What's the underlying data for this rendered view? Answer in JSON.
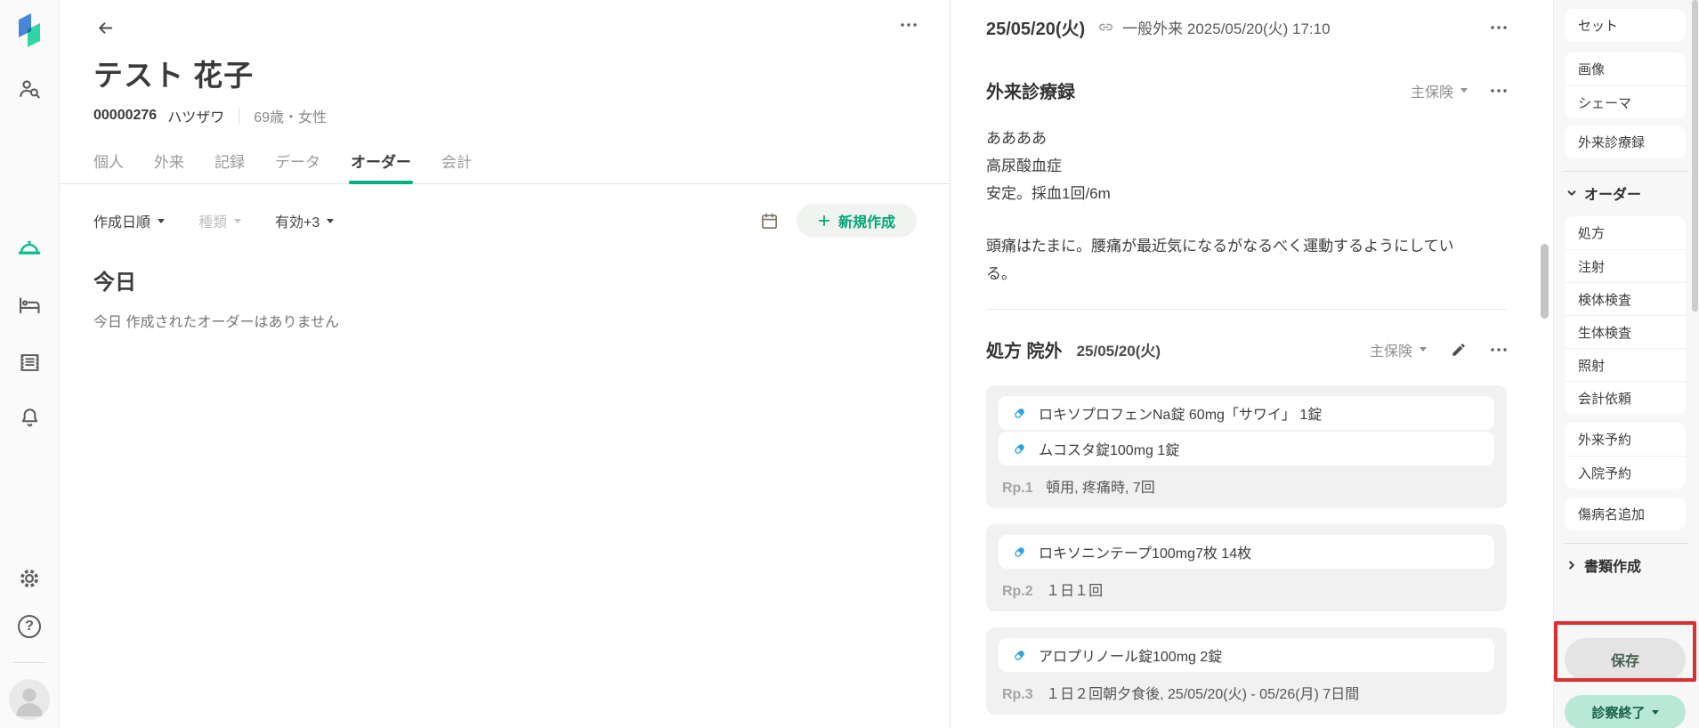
{
  "colors": {
    "accent_green": "#00b183",
    "mint_button_bg": "#b9e8d6",
    "mint_button_text": "#14604a",
    "capsule_blue": "#2ba3e0",
    "highlight_red": "#dc2f2f"
  },
  "patient_header": {
    "name": "テスト 花子",
    "patient_id": "00000276",
    "kana": "ハツザワ",
    "age_sex": "69歳・女性"
  },
  "tabs": {
    "personal": "個人",
    "outpatient": "外来",
    "records": "記録",
    "data": "データ",
    "orders": "オーダー",
    "accounting": "会計"
  },
  "filters": {
    "sort": "作成日順",
    "kind": "種類",
    "status": "有効+3"
  },
  "new_button": "新規作成",
  "today": {
    "heading": "今日",
    "empty": "今日 作成されたオーダーはありません"
  },
  "note": {
    "date": "25/05/20(火)",
    "visit": "一般外来 2025/05/20(火) 17:10",
    "record": {
      "title": "外来診療録",
      "insurance": "主保険",
      "lines": [
        "ああああ",
        "高尿酸血症",
        "安定。採血1回/6m"
      ],
      "paragraph": "頭痛はたまに。腰痛が最近気になるがなるべく運動するようにしている。"
    },
    "rx": {
      "title": "処方 院外",
      "date": "25/05/20(火)",
      "insurance": "主保険",
      "groups": [
        {
          "meds": [
            "ロキソプロフェンNa錠 60mg「サワイ」 1錠",
            "ムコスタ錠100mg 1錠"
          ],
          "rp": "Rp.1",
          "usage": "頓用, 疼痛時, 7回"
        },
        {
          "meds": [
            "ロキソニンテープ100mg7枚 14枚"
          ],
          "rp": "Rp.2",
          "usage": "１日１回"
        },
        {
          "meds": [
            "アロプリノール錠100mg 2錠"
          ],
          "rp": "Rp.3",
          "usage": "１日２回朝夕食後, 25/05/20(火) - 05/26(月) 7日間"
        }
      ]
    }
  },
  "sidebar": {
    "set": "セット",
    "image": "画像",
    "schema": "シェーマ",
    "karte": "外来診療録",
    "order_header": "オーダー",
    "orders": [
      "処方",
      "注射",
      "検体検査",
      "生体検査",
      "照射",
      "会計依頼"
    ],
    "reservations": [
      "外来予約",
      "入院予約"
    ],
    "disease": "傷病名追加",
    "documents_header": "書類作成",
    "save": "保存",
    "finish": "診察終了"
  }
}
